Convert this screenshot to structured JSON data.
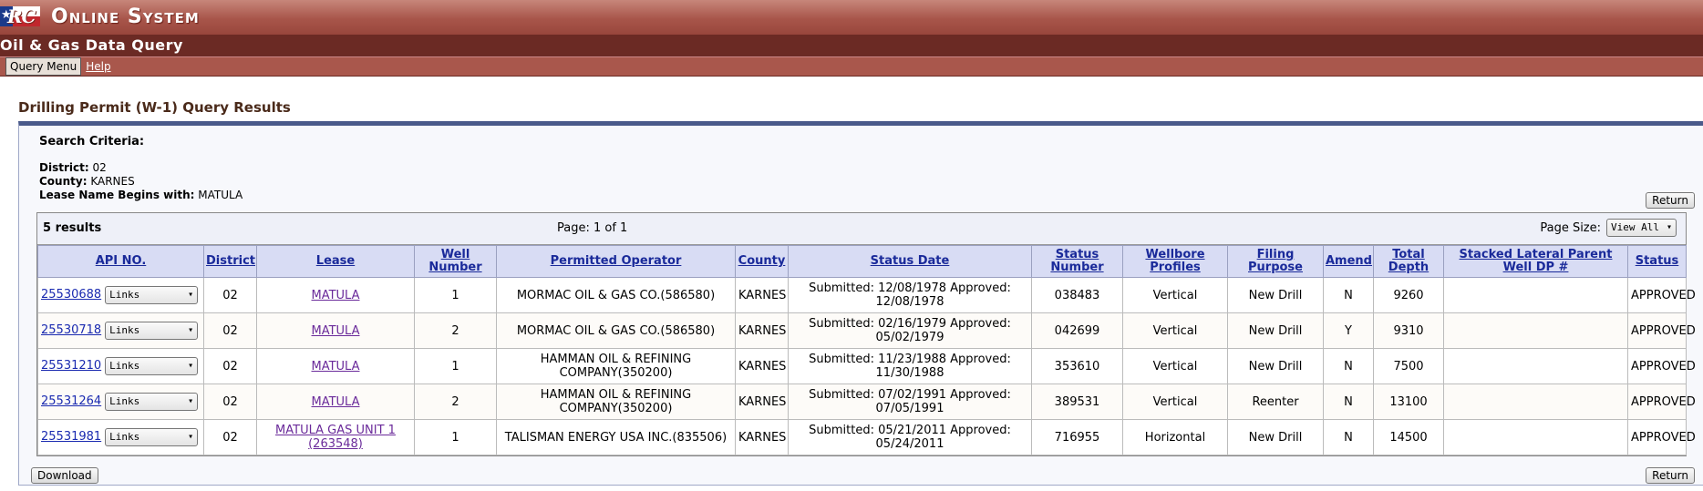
{
  "banner": {
    "logo_text": "RC",
    "star": "★",
    "system_title": "Online System"
  },
  "app_title": "Oil & Gas Data Query",
  "menu": {
    "query_menu": "Query Menu",
    "help": "Help"
  },
  "page_title": "Drilling Permit (W-1) Query Results",
  "criteria": {
    "header": "Search Criteria:",
    "district_label": "District:",
    "district_value": "02",
    "county_label": "County:",
    "county_value": "KARNES",
    "lease_label": "Lease Name Begins with:",
    "lease_value": "MATULA"
  },
  "buttons": {
    "return": "Return",
    "download": "Download"
  },
  "results": {
    "count": "5 results",
    "page": "Page: 1 of 1",
    "page_size_label": "Page Size:",
    "page_size_value": "View All",
    "links_label": "Links",
    "columns": [
      "API NO.",
      "District",
      "Lease",
      "Well Number",
      "Permitted Operator",
      "County",
      "Status Date",
      "Status Number",
      "Wellbore Profiles",
      "Filing Purpose",
      "Amend",
      "Total Depth",
      "Stacked Lateral Parent Well DP #",
      "Status"
    ],
    "rows": [
      {
        "api": "25530688",
        "district": "02",
        "lease": "MATULA",
        "well": "1",
        "operator": "MORMAC OIL & GAS CO.(586580)",
        "county": "KARNES",
        "status_date": "Submitted: 12/08/1978 Approved: 12/08/1978",
        "status_number": "038483",
        "profile": "Vertical",
        "purpose": "New Drill",
        "amend": "N",
        "depth": "9260",
        "stacked": "",
        "status": "APPROVED"
      },
      {
        "api": "25530718",
        "district": "02",
        "lease": "MATULA",
        "well": "2",
        "operator": "MORMAC OIL & GAS CO.(586580)",
        "county": "KARNES",
        "status_date": "Submitted: 02/16/1979 Approved: 05/02/1979",
        "status_number": "042699",
        "profile": "Vertical",
        "purpose": "New Drill",
        "amend": "Y",
        "depth": "9310",
        "stacked": "",
        "status": "APPROVED"
      },
      {
        "api": "25531210",
        "district": "02",
        "lease": "MATULA",
        "well": "1",
        "operator": "HAMMAN OIL & REFINING COMPANY(350200)",
        "county": "KARNES",
        "status_date": "Submitted: 11/23/1988 Approved: 11/30/1988",
        "status_number": "353610",
        "profile": "Vertical",
        "purpose": "New Drill",
        "amend": "N",
        "depth": "7500",
        "stacked": "",
        "status": "APPROVED"
      },
      {
        "api": "25531264",
        "district": "02",
        "lease": "MATULA",
        "well": "2",
        "operator": "HAMMAN OIL & REFINING COMPANY(350200)",
        "county": "KARNES",
        "status_date": "Submitted: 07/02/1991 Approved: 07/05/1991",
        "status_number": "389531",
        "profile": "Vertical",
        "purpose": "Reenter",
        "amend": "N",
        "depth": "13100",
        "stacked": "",
        "status": "APPROVED"
      },
      {
        "api": "25531981",
        "district": "02",
        "lease": "MATULA GAS UNIT 1 (263548)",
        "well": "1",
        "operator": "TALISMAN ENERGY USA INC.(835506)",
        "county": "KARNES",
        "status_date": "Submitted: 05/21/2011 Approved: 05/24/2011",
        "status_number": "716955",
        "profile": "Horizontal",
        "purpose": "New Drill",
        "amend": "N",
        "depth": "14500",
        "stacked": "",
        "status": "APPROVED"
      }
    ]
  }
}
